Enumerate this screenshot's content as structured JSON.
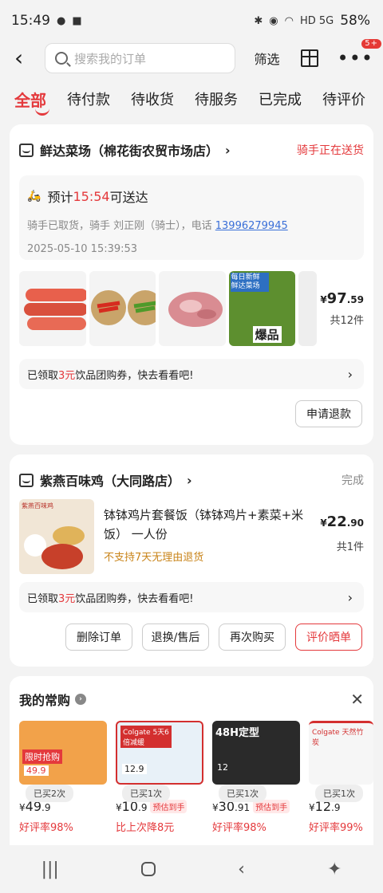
{
  "status": {
    "time": "15:49",
    "battery": "58%",
    "net": "HD 5G"
  },
  "header": {
    "search_placeholder": "搜索我的订单",
    "filter_label": "筛选",
    "badge": "5+"
  },
  "tabs": [
    "全部",
    "待付款",
    "待收货",
    "待服务",
    "已完成",
    "待评价"
  ],
  "order1": {
    "store": "鲜达菜场（棉花街农贸市场店）",
    "status": "骑手正在送货",
    "eta_pre": "预计",
    "eta_time": "15:54",
    "eta_post": "可送达",
    "rider_text": "骑手已取货，骑手 刘正刚（骑士），电话 ",
    "phone": "13996279945",
    "time": "2025-05-10 15:39:53",
    "price_symbol": "¥",
    "price_int": "97",
    "price_dec": ".59",
    "count": "共12件",
    "coupon_pre": "已领取",
    "coupon_amount": "3元",
    "coupon_post": "饮品团购券，快去看看吧!",
    "refund_btn": "申请退款",
    "img4_tag": "每日新鲜 鲜达菜场",
    "img4_label": "爆品"
  },
  "order2": {
    "store": "紫燕百味鸡（大同路店）",
    "status": "完成",
    "img_brand": "紫燕百味鸡",
    "product": "钵钵鸡片套餐饭（钵钵鸡片+素菜+米饭） 一人份",
    "note": "不支持7天无理由退货",
    "price_symbol": "¥",
    "price_int": "22",
    "price_dec": ".90",
    "count": "共1件",
    "coupon_pre": "已领取",
    "coupon_amount": "3元",
    "coupon_post": "饮品团购券，快去看看吧!",
    "buttons": [
      "删除订单",
      "退换/售后",
      "再次购买",
      "评价晒单"
    ]
  },
  "favorites": {
    "title": "我的常购",
    "items": [
      {
        "bought": "已买2次",
        "sym": "¥",
        "int": "49",
        "dec": ".9",
        "tag": "",
        "note": "好评率98%",
        "img_text": "限时抢购",
        "img_price": "49.9"
      },
      {
        "bought": "已买1次",
        "sym": "¥",
        "int": "10",
        "dec": ".9",
        "tag": "预估到手",
        "note": "比上次降8元",
        "img_text": "Colgate 5天6倍减缓",
        "img_price": "12.9"
      },
      {
        "bought": "已买1次",
        "sym": "¥",
        "int": "30",
        "dec": ".91",
        "tag": "预估到手",
        "note": "好评率98%",
        "img_text": "48H定型",
        "img_price": "12"
      },
      {
        "bought": "已买1次",
        "sym": "¥",
        "int": "12",
        "dec": ".9",
        "tag": "",
        "note": "好评率99%",
        "img_text": "Colgate 天然竹炭",
        "img_price": ""
      }
    ]
  },
  "colors": {
    "accent": "#e4393c",
    "link": "#3a6fd8"
  }
}
